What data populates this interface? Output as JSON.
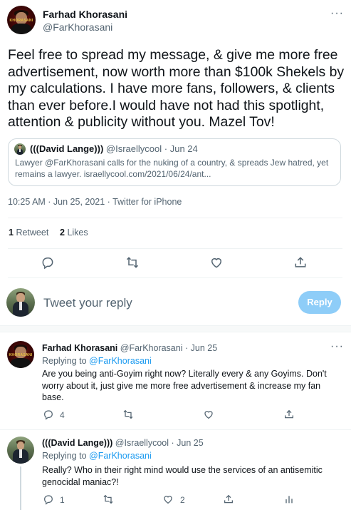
{
  "main_tweet": {
    "author_name": "Farhad Khorasani",
    "author_handle": "@FarKhorasani",
    "text": "Feel free to spread my message, & give me more free advertisement, now worth more than $100k Shekels by my calculations. I have more fans, followers, & clients than ever before.I would have not had this spotlight, attention & publicity without you. Mazel Tov!",
    "quoted": {
      "author_name": "(((David Lange)))",
      "author_handle": "@Israellycool",
      "separator": "·",
      "date": "Jun 24",
      "text": "Lawyer @FarKhorasani calls for the nuking of a country, & spreads Jew hatred, yet remains a lawyer. israellycool.com/2021/06/24/ant..."
    },
    "timestamp": "10:25 AM · Jun 25, 2021 · Twitter for iPhone",
    "retweets_count": "1",
    "retweets_label": "Retweet",
    "likes_count": "2",
    "likes_label": "Likes"
  },
  "reply_box": {
    "placeholder": "Tweet your reply",
    "button_label": "Reply"
  },
  "replies": [
    {
      "author_name": "Farhad Khorasani",
      "author_handle": "@FarKhorasani",
      "separator": "·",
      "date": "Jun 25",
      "replying_to_label": "Replying to",
      "replying_to_handle": "@FarKhorasani",
      "text": "Are you being anti-Goyim right now? Literally every & any Goyims. Don't worry about it, just give me more free advertisement & increase my fan base.",
      "reply_count": "4",
      "retweet_count": "",
      "like_count": ""
    },
    {
      "author_name": "(((David Lange)))",
      "author_handle": "@Israellycool",
      "separator": "·",
      "date": "Jun 25",
      "replying_to_label": "Replying to",
      "replying_to_handle": "@FarKhorasani",
      "text": "Really? Who in their right mind would use the services of an antisemitic genocidal maniac?!",
      "reply_count": "1",
      "retweet_count": "",
      "like_count": "2"
    }
  ],
  "icons": {
    "more": "more-dots-icon",
    "reply": "reply-icon",
    "retweet": "retweet-icon",
    "like": "heart-icon",
    "share": "share-icon",
    "analytics": "analytics-icon"
  },
  "colors": {
    "accent": "#1d9bf0",
    "reply_button_disabled": "#8ecdf8",
    "text_primary": "#0f1419",
    "text_secondary": "#536471",
    "divider": "#eff3f4"
  }
}
